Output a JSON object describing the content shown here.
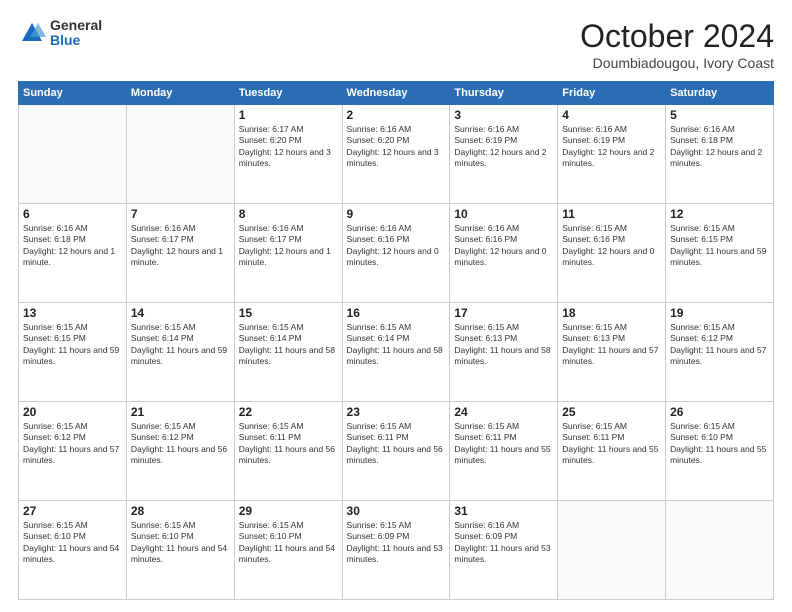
{
  "header": {
    "logo_general": "General",
    "logo_blue": "Blue",
    "month_title": "October 2024",
    "location": "Doumbiadougou, Ivory Coast"
  },
  "days_of_week": [
    "Sunday",
    "Monday",
    "Tuesday",
    "Wednesday",
    "Thursday",
    "Friday",
    "Saturday"
  ],
  "weeks": [
    [
      {
        "day": "",
        "content": ""
      },
      {
        "day": "",
        "content": ""
      },
      {
        "day": "1",
        "content": "Sunrise: 6:17 AM\nSunset: 6:20 PM\nDaylight: 12 hours and 3 minutes."
      },
      {
        "day": "2",
        "content": "Sunrise: 6:16 AM\nSunset: 6:20 PM\nDaylight: 12 hours and 3 minutes."
      },
      {
        "day": "3",
        "content": "Sunrise: 6:16 AM\nSunset: 6:19 PM\nDaylight: 12 hours and 2 minutes."
      },
      {
        "day": "4",
        "content": "Sunrise: 6:16 AM\nSunset: 6:19 PM\nDaylight: 12 hours and 2 minutes."
      },
      {
        "day": "5",
        "content": "Sunrise: 6:16 AM\nSunset: 6:18 PM\nDaylight: 12 hours and 2 minutes."
      }
    ],
    [
      {
        "day": "6",
        "content": "Sunrise: 6:16 AM\nSunset: 6:18 PM\nDaylight: 12 hours and 1 minute."
      },
      {
        "day": "7",
        "content": "Sunrise: 6:16 AM\nSunset: 6:17 PM\nDaylight: 12 hours and 1 minute."
      },
      {
        "day": "8",
        "content": "Sunrise: 6:16 AM\nSunset: 6:17 PM\nDaylight: 12 hours and 1 minute."
      },
      {
        "day": "9",
        "content": "Sunrise: 6:16 AM\nSunset: 6:16 PM\nDaylight: 12 hours and 0 minutes."
      },
      {
        "day": "10",
        "content": "Sunrise: 6:16 AM\nSunset: 6:16 PM\nDaylight: 12 hours and 0 minutes."
      },
      {
        "day": "11",
        "content": "Sunrise: 6:15 AM\nSunset: 6:16 PM\nDaylight: 12 hours and 0 minutes."
      },
      {
        "day": "12",
        "content": "Sunrise: 6:15 AM\nSunset: 6:15 PM\nDaylight: 11 hours and 59 minutes."
      }
    ],
    [
      {
        "day": "13",
        "content": "Sunrise: 6:15 AM\nSunset: 6:15 PM\nDaylight: 11 hours and 59 minutes."
      },
      {
        "day": "14",
        "content": "Sunrise: 6:15 AM\nSunset: 6:14 PM\nDaylight: 11 hours and 59 minutes."
      },
      {
        "day": "15",
        "content": "Sunrise: 6:15 AM\nSunset: 6:14 PM\nDaylight: 11 hours and 58 minutes."
      },
      {
        "day": "16",
        "content": "Sunrise: 6:15 AM\nSunset: 6:14 PM\nDaylight: 11 hours and 58 minutes."
      },
      {
        "day": "17",
        "content": "Sunrise: 6:15 AM\nSunset: 6:13 PM\nDaylight: 11 hours and 58 minutes."
      },
      {
        "day": "18",
        "content": "Sunrise: 6:15 AM\nSunset: 6:13 PM\nDaylight: 11 hours and 57 minutes."
      },
      {
        "day": "19",
        "content": "Sunrise: 6:15 AM\nSunset: 6:12 PM\nDaylight: 11 hours and 57 minutes."
      }
    ],
    [
      {
        "day": "20",
        "content": "Sunrise: 6:15 AM\nSunset: 6:12 PM\nDaylight: 11 hours and 57 minutes."
      },
      {
        "day": "21",
        "content": "Sunrise: 6:15 AM\nSunset: 6:12 PM\nDaylight: 11 hours and 56 minutes."
      },
      {
        "day": "22",
        "content": "Sunrise: 6:15 AM\nSunset: 6:11 PM\nDaylight: 11 hours and 56 minutes."
      },
      {
        "day": "23",
        "content": "Sunrise: 6:15 AM\nSunset: 6:11 PM\nDaylight: 11 hours and 56 minutes."
      },
      {
        "day": "24",
        "content": "Sunrise: 6:15 AM\nSunset: 6:11 PM\nDaylight: 11 hours and 55 minutes."
      },
      {
        "day": "25",
        "content": "Sunrise: 6:15 AM\nSunset: 6:11 PM\nDaylight: 11 hours and 55 minutes."
      },
      {
        "day": "26",
        "content": "Sunrise: 6:15 AM\nSunset: 6:10 PM\nDaylight: 11 hours and 55 minutes."
      }
    ],
    [
      {
        "day": "27",
        "content": "Sunrise: 6:15 AM\nSunset: 6:10 PM\nDaylight: 11 hours and 54 minutes."
      },
      {
        "day": "28",
        "content": "Sunrise: 6:15 AM\nSunset: 6:10 PM\nDaylight: 11 hours and 54 minutes."
      },
      {
        "day": "29",
        "content": "Sunrise: 6:15 AM\nSunset: 6:10 PM\nDaylight: 11 hours and 54 minutes."
      },
      {
        "day": "30",
        "content": "Sunrise: 6:15 AM\nSunset: 6:09 PM\nDaylight: 11 hours and 53 minutes."
      },
      {
        "day": "31",
        "content": "Sunrise: 6:16 AM\nSunset: 6:09 PM\nDaylight: 11 hours and 53 minutes."
      },
      {
        "day": "",
        "content": ""
      },
      {
        "day": "",
        "content": ""
      }
    ]
  ]
}
